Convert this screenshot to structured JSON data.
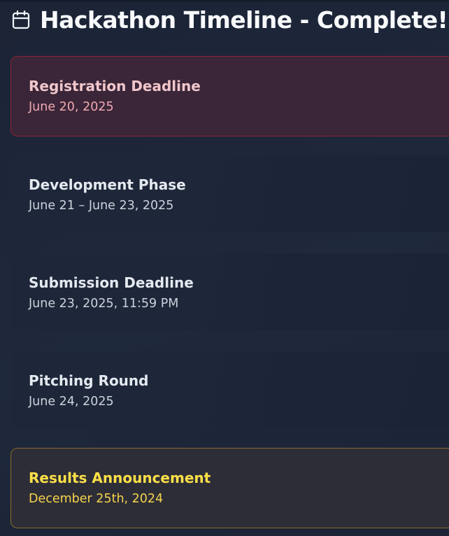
{
  "header": {
    "icon": "calendar-icon",
    "title": "Hackathon Timeline - Complete!"
  },
  "events": [
    {
      "title": "Registration Deadline",
      "date": "June 20, 2025",
      "style": "highlight-red"
    },
    {
      "title": "Development Phase",
      "date": "June 21 – June 23, 2025",
      "style": "plain"
    },
    {
      "title": "Submission Deadline",
      "date": "June 23, 2025, 11:59 PM",
      "style": "plain"
    },
    {
      "title": "Pitching Round",
      "date": "June 24, 2025",
      "style": "plain"
    },
    {
      "title": "Results Announcement",
      "date": "December 25th, 2024",
      "style": "highlight-gold"
    }
  ],
  "colors": {
    "background": "#1e293b",
    "red_accent": "#8b2337",
    "gold_accent": "#fde047"
  }
}
